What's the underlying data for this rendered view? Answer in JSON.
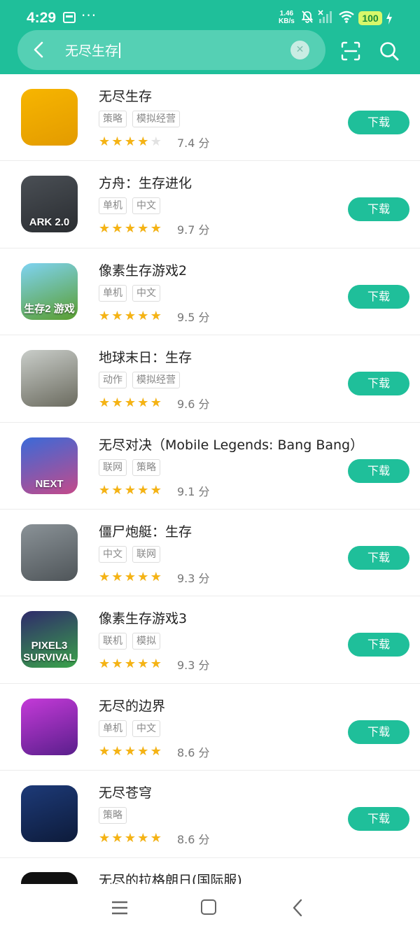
{
  "status_bar": {
    "time": "4:29",
    "dots": "···",
    "net_speed_value": "1.46",
    "net_speed_unit": "KB/s",
    "battery": "100"
  },
  "search": {
    "query": "无尽生存"
  },
  "apps": [
    {
      "name": "无尽生存",
      "tags": [
        "策略",
        "模拟经营"
      ],
      "rating": 3.5,
      "score": "7.4 分",
      "button": "下载",
      "icon_colors": [
        "#f7b500",
        "#e39b00"
      ]
    },
    {
      "name": "方舟：生存进化",
      "tags": [
        "单机",
        "中文"
      ],
      "rating": 5,
      "score": "9.7 分",
      "button": "下载",
      "icon_colors": [
        "#4a4f55",
        "#2a2d31"
      ],
      "icon_text": "ARK 2.0"
    },
    {
      "name": "像素生存游戏2",
      "tags": [
        "单机",
        "中文"
      ],
      "rating": 5,
      "score": "9.5 分",
      "button": "下载",
      "icon_colors": [
        "#7fd3f2",
        "#5a9e2f"
      ],
      "icon_text": "生存2 游戏"
    },
    {
      "name": "地球末日：生存",
      "tags": [
        "动作",
        "模拟经营"
      ],
      "rating": 5,
      "score": "9.6 分",
      "button": "下载",
      "icon_colors": [
        "#c9cdc9",
        "#6b6b5f"
      ]
    },
    {
      "name": "无尽对决（Mobile Legends: Bang Bang）",
      "tags": [
        "联网",
        "策略"
      ],
      "rating": 4.5,
      "score": "9.1 分",
      "button": "下载",
      "icon_colors": [
        "#3a6ad8",
        "#c44a8a"
      ],
      "icon_text": "NEXT"
    },
    {
      "name": "僵尸炮艇：生存",
      "tags": [
        "中文",
        "联网"
      ],
      "rating": 4.5,
      "score": "9.3 分",
      "button": "下载",
      "icon_colors": [
        "#8a9297",
        "#4f5559"
      ]
    },
    {
      "name": "像素生存游戏3",
      "tags": [
        "联机",
        "模拟"
      ],
      "rating": 4.5,
      "score": "9.3 分",
      "button": "下载",
      "icon_colors": [
        "#2f2a6b",
        "#3aa34a"
      ],
      "icon_text": "PIXEL3 SURVIVAL"
    },
    {
      "name": "无尽的边界",
      "tags": [
        "单机",
        "中文"
      ],
      "rating": 4.5,
      "score": "8.6 分",
      "button": "下载",
      "icon_colors": [
        "#c43ad8",
        "#5a1f8c"
      ]
    },
    {
      "name": "无尽苍穹",
      "tags": [
        "策略"
      ],
      "rating": 4.5,
      "score": "8.6 分",
      "button": "下载",
      "icon_colors": [
        "#1d3a78",
        "#0d1b3a"
      ]
    }
  ],
  "partial_app": {
    "name": "无尽的拉格朗日(国际服)"
  },
  "colors": {
    "accent": "#1fbf9a",
    "star": "#f5b314"
  }
}
